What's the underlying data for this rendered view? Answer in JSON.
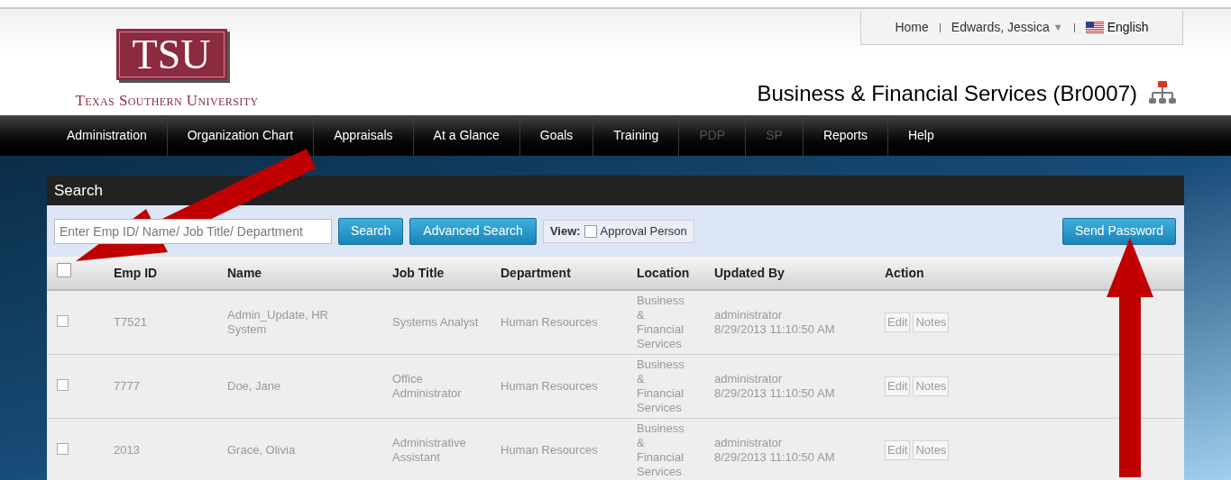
{
  "logo": {
    "mark": "TSU",
    "name": "Texas Southern University"
  },
  "top_links": [
    {
      "kind": "link",
      "label": "Home"
    },
    {
      "kind": "user",
      "label": "Edwards, Jessica",
      "caret": "▼"
    },
    {
      "kind": "language",
      "label": "English"
    }
  ],
  "page_title": "Business & Financial Services (Br0007)",
  "nav": [
    {
      "label": "Administration",
      "disabled": false
    },
    {
      "label": "Organization Chart",
      "disabled": false
    },
    {
      "label": "Appraisals",
      "disabled": false
    },
    {
      "label": "At a Glance",
      "disabled": false
    },
    {
      "label": "Goals",
      "disabled": false
    },
    {
      "label": "Training",
      "disabled": false
    },
    {
      "label": "PDP",
      "disabled": true
    },
    {
      "label": "SP",
      "disabled": true
    },
    {
      "label": "Reports",
      "disabled": false
    },
    {
      "label": "Help",
      "disabled": false
    }
  ],
  "panel_title": "Search",
  "search": {
    "placeholder": "Enter Emp ID/ Name/ Job Title/ Department",
    "search_button": "Search",
    "advanced_button": "Advanced Search",
    "view_label": "View:",
    "view_option": {
      "label": "Approval Person",
      "checked": false
    },
    "send_button": "Send Password"
  },
  "table": {
    "select_all": {
      "checked": false
    },
    "columns": [
      "Emp ID",
      "Name",
      "Job Title",
      "Department",
      "Location",
      "Updated By",
      "Action"
    ],
    "rows": [
      {
        "checked": false,
        "emp_id": "T7521",
        "name": "Admin_Update, HR System",
        "job_title": "Systems Analyst",
        "department": "Human Resources",
        "location": "Business & Financial Services",
        "updated_by": "administrator",
        "updated_at": "8/29/2013 11:10:50 AM",
        "actions": [
          {
            "label": "Edit",
            "disabled": true
          },
          {
            "label": "Notes",
            "disabled": true
          }
        ]
      },
      {
        "checked": false,
        "emp_id": "7777",
        "name": "Doe, Jane",
        "job_title": "Office Administrator",
        "department": "Human Resources",
        "location": "Business & Financial Services",
        "updated_by": "administrator",
        "updated_at": "8/29/2013 11:10:50 AM",
        "actions": [
          {
            "label": "Edit",
            "disabled": true
          },
          {
            "label": "Notes",
            "disabled": true
          }
        ]
      },
      {
        "checked": false,
        "emp_id": "2013",
        "name": "Grace, Olivia",
        "job_title": "Administrative Assistant",
        "department": "Human Resources",
        "location": "Business & Financial Services",
        "updated_by": "administrator",
        "updated_at": "8/29/2013 11:10:50 AM",
        "actions": [
          {
            "label": "Edit",
            "disabled": true
          },
          {
            "label": "Notes",
            "disabled": true
          }
        ]
      }
    ]
  }
}
